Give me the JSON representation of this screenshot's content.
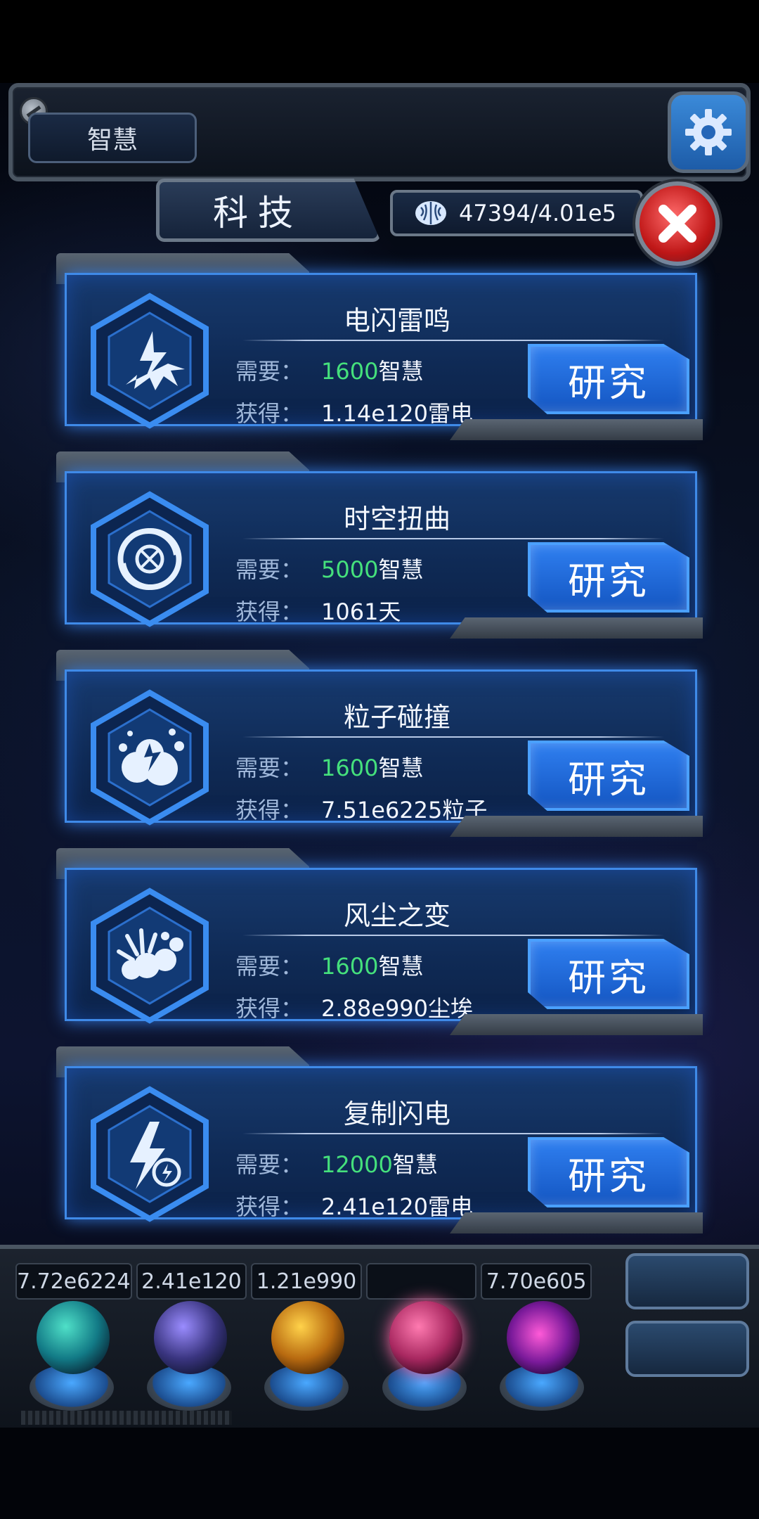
{
  "header": {
    "wisdom_tab_label": "智慧"
  },
  "panel": {
    "title": "科技",
    "resource_display": "47394/4.01e5"
  },
  "labels": {
    "require": "需要：",
    "gain": "获得：",
    "research": "研究"
  },
  "techs": [
    {
      "name": "电闪雷鸣",
      "cost": "1600",
      "cost_unit": "智慧",
      "reward": "1.14e120雷电",
      "icon": "lightning-burst-icon"
    },
    {
      "name": "时空扭曲",
      "cost": "5000",
      "cost_unit": "智慧",
      "reward": "1061天",
      "icon": "vortex-icon"
    },
    {
      "name": "粒子碰撞",
      "cost": "1600",
      "cost_unit": "智慧",
      "reward": "7.51e6225粒子",
      "icon": "particle-collision-icon"
    },
    {
      "name": "风尘之变",
      "cost": "1600",
      "cost_unit": "智慧",
      "reward": "2.88e990尘埃",
      "icon": "dust-explosion-icon"
    },
    {
      "name": "复制闪电",
      "cost": "12000",
      "cost_unit": "智慧",
      "reward": "2.41e120雷电",
      "icon": "copy-lightning-icon"
    }
  ],
  "bottom_bar": {
    "resources": [
      "7.72e6224",
      "2.41e120",
      "1.21e990",
      "",
      "7.70e605"
    ]
  },
  "colors": {
    "accent_blue": "#2f7ff0",
    "cost_green": "#45e07c",
    "close_red": "#c01818"
  }
}
